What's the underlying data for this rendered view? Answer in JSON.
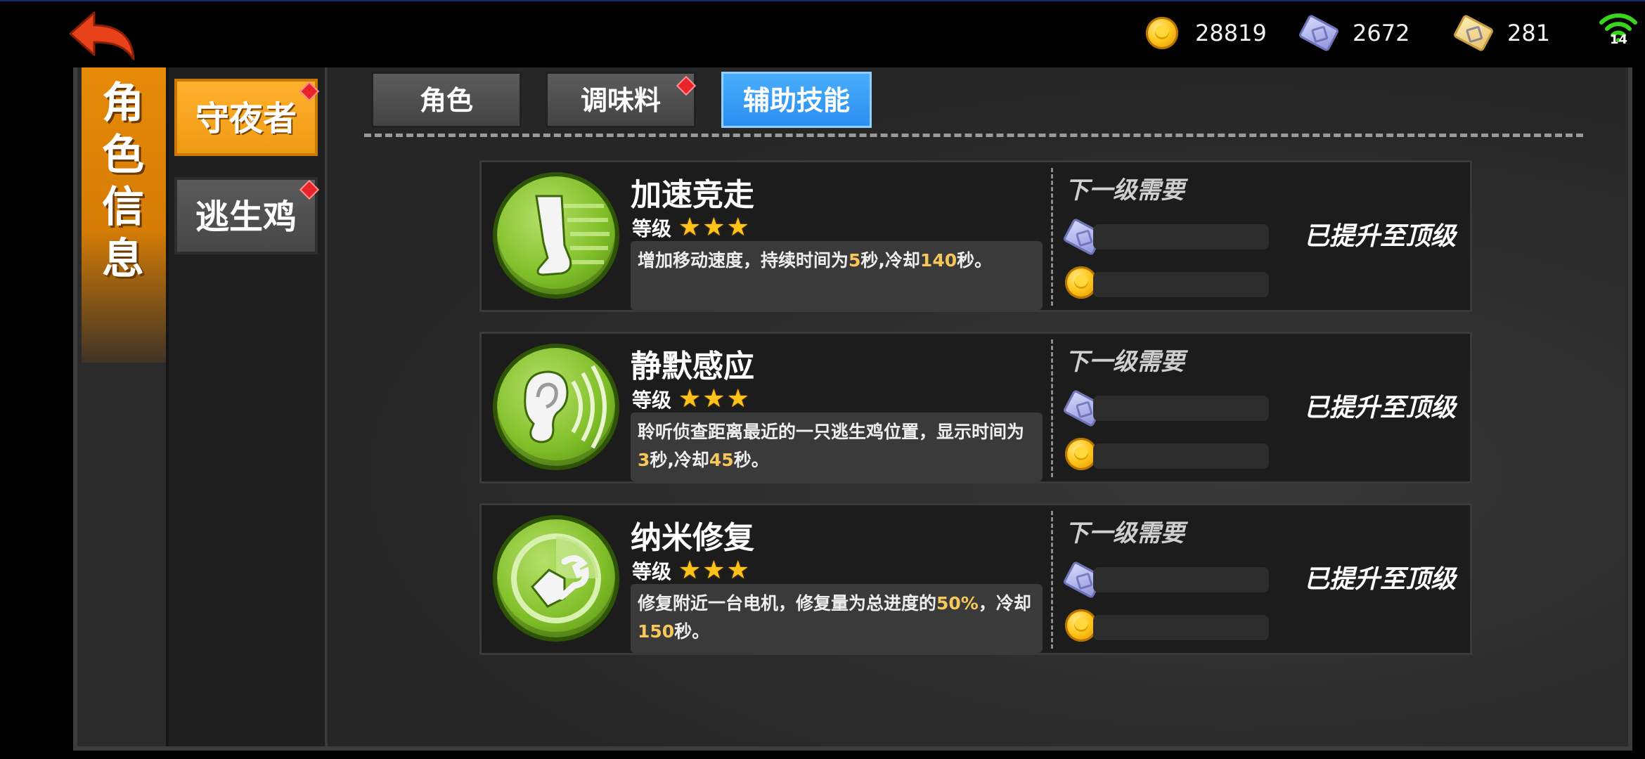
{
  "currencies": [
    {
      "icon": "coin-icon",
      "value": "28819"
    },
    {
      "icon": "purple-ticket-icon",
      "value": "2672"
    },
    {
      "icon": "gold-ticket-icon",
      "value": "281"
    }
  ],
  "signal": {
    "icon": "wifi-icon",
    "value": "14"
  },
  "sidebar": {
    "title": "角\n色\n信\n息"
  },
  "roles": [
    {
      "label": "守夜者",
      "selected": true,
      "badge": true
    },
    {
      "label": "逃生鸡",
      "selected": false,
      "badge": true
    }
  ],
  "tabs": [
    {
      "label": "角色",
      "selected": false,
      "badge": false
    },
    {
      "label": "调味料",
      "selected": false,
      "badge": true
    },
    {
      "label": "辅助技能",
      "selected": true,
      "badge": false
    }
  ],
  "skills": [
    {
      "icon": "foot-speed-icon",
      "name": "加速竞走",
      "level_label": "等级",
      "stars": 3,
      "desc_parts": [
        "增加移动速度，持续时间为",
        "5",
        "秒,冷却",
        "140",
        "秒。"
      ],
      "req_label": "下一级需要",
      "status": "已提升至顶级"
    },
    {
      "icon": "ear-listen-icon",
      "name": "静默感应",
      "level_label": "等级",
      "stars": 3,
      "desc_parts": [
        "聆听侦查距离最近的一只逃生鸡位置，显示时间为",
        "3",
        "秒,冷却",
        "45",
        "秒。"
      ],
      "req_label": "下一级需要",
      "status": "已提升至顶级"
    },
    {
      "icon": "wrench-repair-icon",
      "name": "纳米修复",
      "level_label": "等级",
      "stars": 3,
      "desc_parts": [
        "修复附近一台电机，修复量为总进度的",
        "50%",
        "，冷却",
        "150",
        "秒。"
      ],
      "req_label": "下一级需要",
      "status": "已提升至顶级"
    }
  ],
  "colors": {
    "accent_orange": "#f09a14",
    "tab_blue": "#2b8ef0",
    "highlight": "#f6c85a",
    "star": "#ffc21a"
  }
}
